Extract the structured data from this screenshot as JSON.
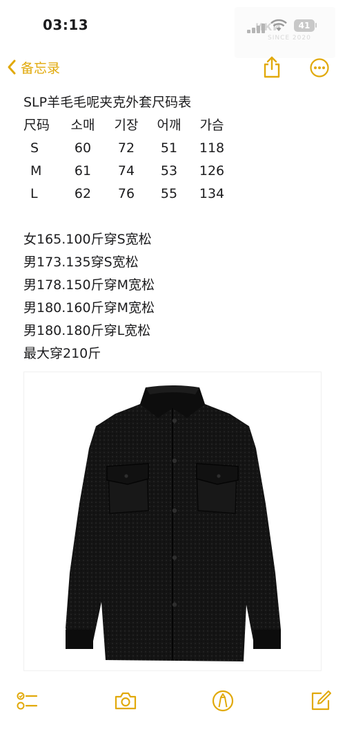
{
  "status_bar": {
    "time": "03:13",
    "battery": "41",
    "watermark_brand": "ИКИ",
    "watermark_since": "SINCE 2020"
  },
  "nav": {
    "back_label": "备忘录",
    "accent_color": "#e1a90a"
  },
  "note": {
    "title": "SLP羊毛毛呢夹克外套尺码表",
    "table_headers": [
      "尺码",
      "소매",
      "기장",
      "어깨",
      "가슴"
    ],
    "table_rows": [
      [
        "S",
        "60",
        "72",
        "51",
        "118"
      ],
      [
        "M",
        "61",
        "74",
        "53",
        "126"
      ],
      [
        "L",
        "62",
        "76",
        "55",
        "134"
      ]
    ],
    "fit_lines": [
      "女165.100斤穿S宽松",
      "男173.135穿S宽松",
      "男178.150斤穿M宽松",
      "男180.160斤穿M宽松",
      "男180.180斤穿L宽松",
      "最大穿210斤"
    ]
  },
  "toolbar": {
    "icons": [
      "checklist-icon",
      "camera-icon",
      "markup-pen-icon",
      "compose-icon"
    ]
  }
}
